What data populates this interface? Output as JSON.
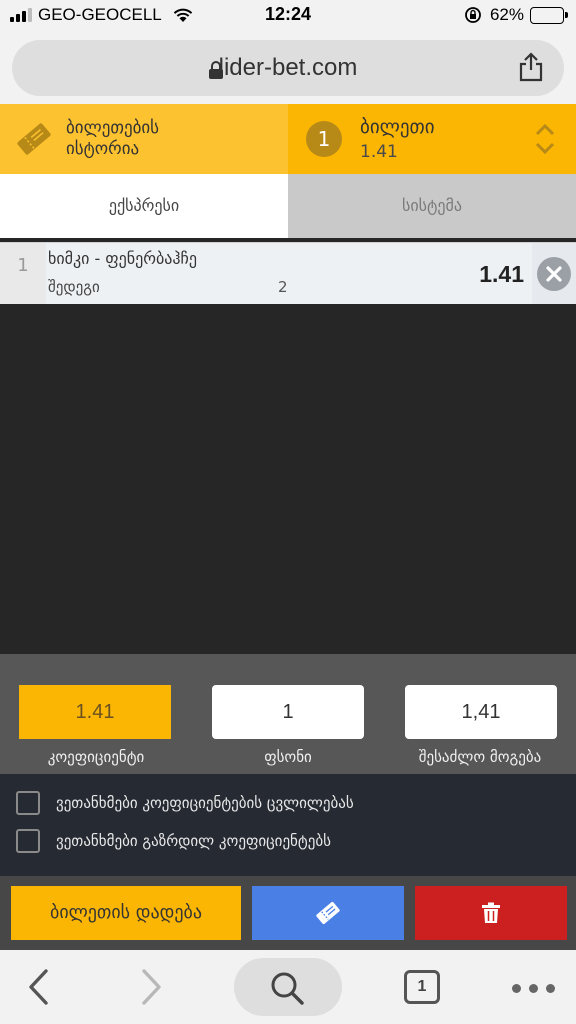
{
  "status_bar": {
    "carrier": "GEO-GEOCELL",
    "time": "12:24",
    "battery": "62%",
    "battery_level": 0.62
  },
  "browser": {
    "url": "lider-bet.com"
  },
  "header": {
    "history_label": "ბილეთების ისტორია",
    "slip_count": "1",
    "slip_title": "ბილეთი",
    "slip_odds": "1.41"
  },
  "tabs": [
    {
      "label": "ექსპრესი",
      "active": true
    },
    {
      "label": "სისტემა",
      "active": false
    }
  ],
  "bets": [
    {
      "index": "1",
      "match": "ხიმკი - ფენერბაჰჩე",
      "market": "შედეგი",
      "outcome": "2",
      "odds": "1.41"
    }
  ],
  "stake_panel": {
    "coefficient_value": "1.41",
    "coefficient_label": "კოეფიციენტი",
    "stake_value": "1",
    "stake_label": "ფსონი",
    "win_value": "1,41",
    "win_label": "შესაძლო მოგება"
  },
  "options": {
    "accept_odds_changes": "ვეთანხმები კოეფიციენტების ცვლილებას",
    "accept_increased_odds": "ვეთანხმები გაზრდილ კოეფიციენტებს"
  },
  "actions": {
    "place_bet": "ბილეთის დადება"
  },
  "toolbar": {
    "tab_count": "1"
  },
  "colors": {
    "accent": "#fbb604",
    "accent_light": "#fdc22f",
    "share_blue": "#4a7fe6",
    "delete_red": "#cc1f1f"
  }
}
